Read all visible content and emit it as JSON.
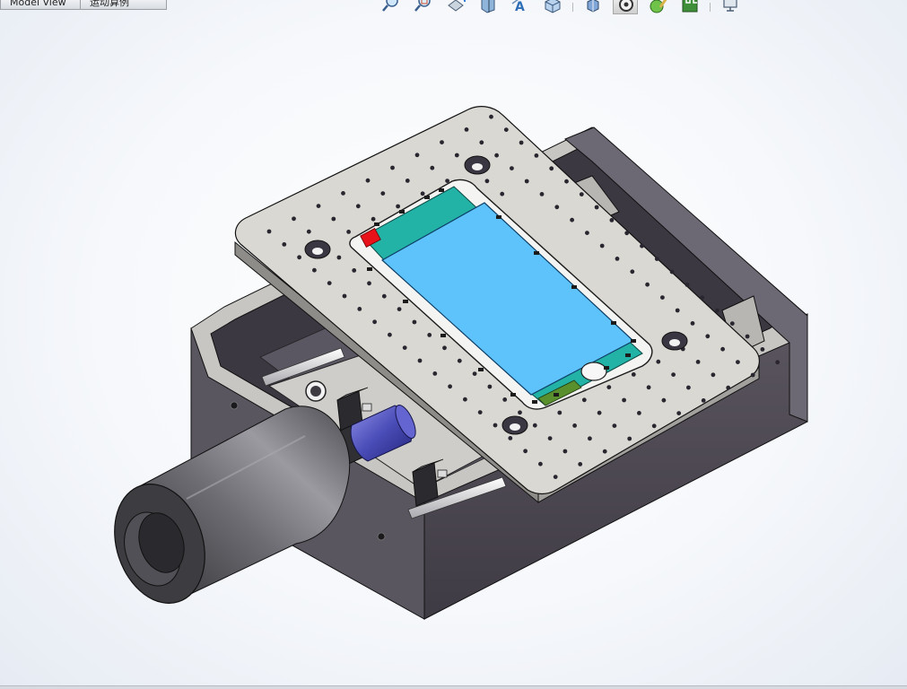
{
  "tabs": [
    {
      "label": "Model View"
    },
    {
      "label": "运动算例"
    }
  ],
  "toolbar": {
    "icons": [
      {
        "name": "zoom-to-fit-icon"
      },
      {
        "name": "zoom-to-area-icon"
      },
      {
        "name": "previous-view-icon"
      },
      {
        "name": "section-view-icon"
      },
      {
        "name": "dynamic-annotation-icon"
      },
      {
        "name": "view-orientation-icon"
      },
      {
        "name": "display-style-icon"
      },
      {
        "name": "hide-show-items-icon"
      },
      {
        "name": "edit-appearance-icon"
      },
      {
        "name": "apply-scene-icon"
      },
      {
        "name": "view-settings-icon"
      }
    ],
    "active_index": 7
  },
  "colors": {
    "plate": "#d9d7d2",
    "box": "#4e4a52",
    "screen": "#5fc3fb",
    "pcb": "#22b3a6",
    "red_component": "#e8121b",
    "motor": "#4a4a4f",
    "coupling": "#4b4db8"
  }
}
